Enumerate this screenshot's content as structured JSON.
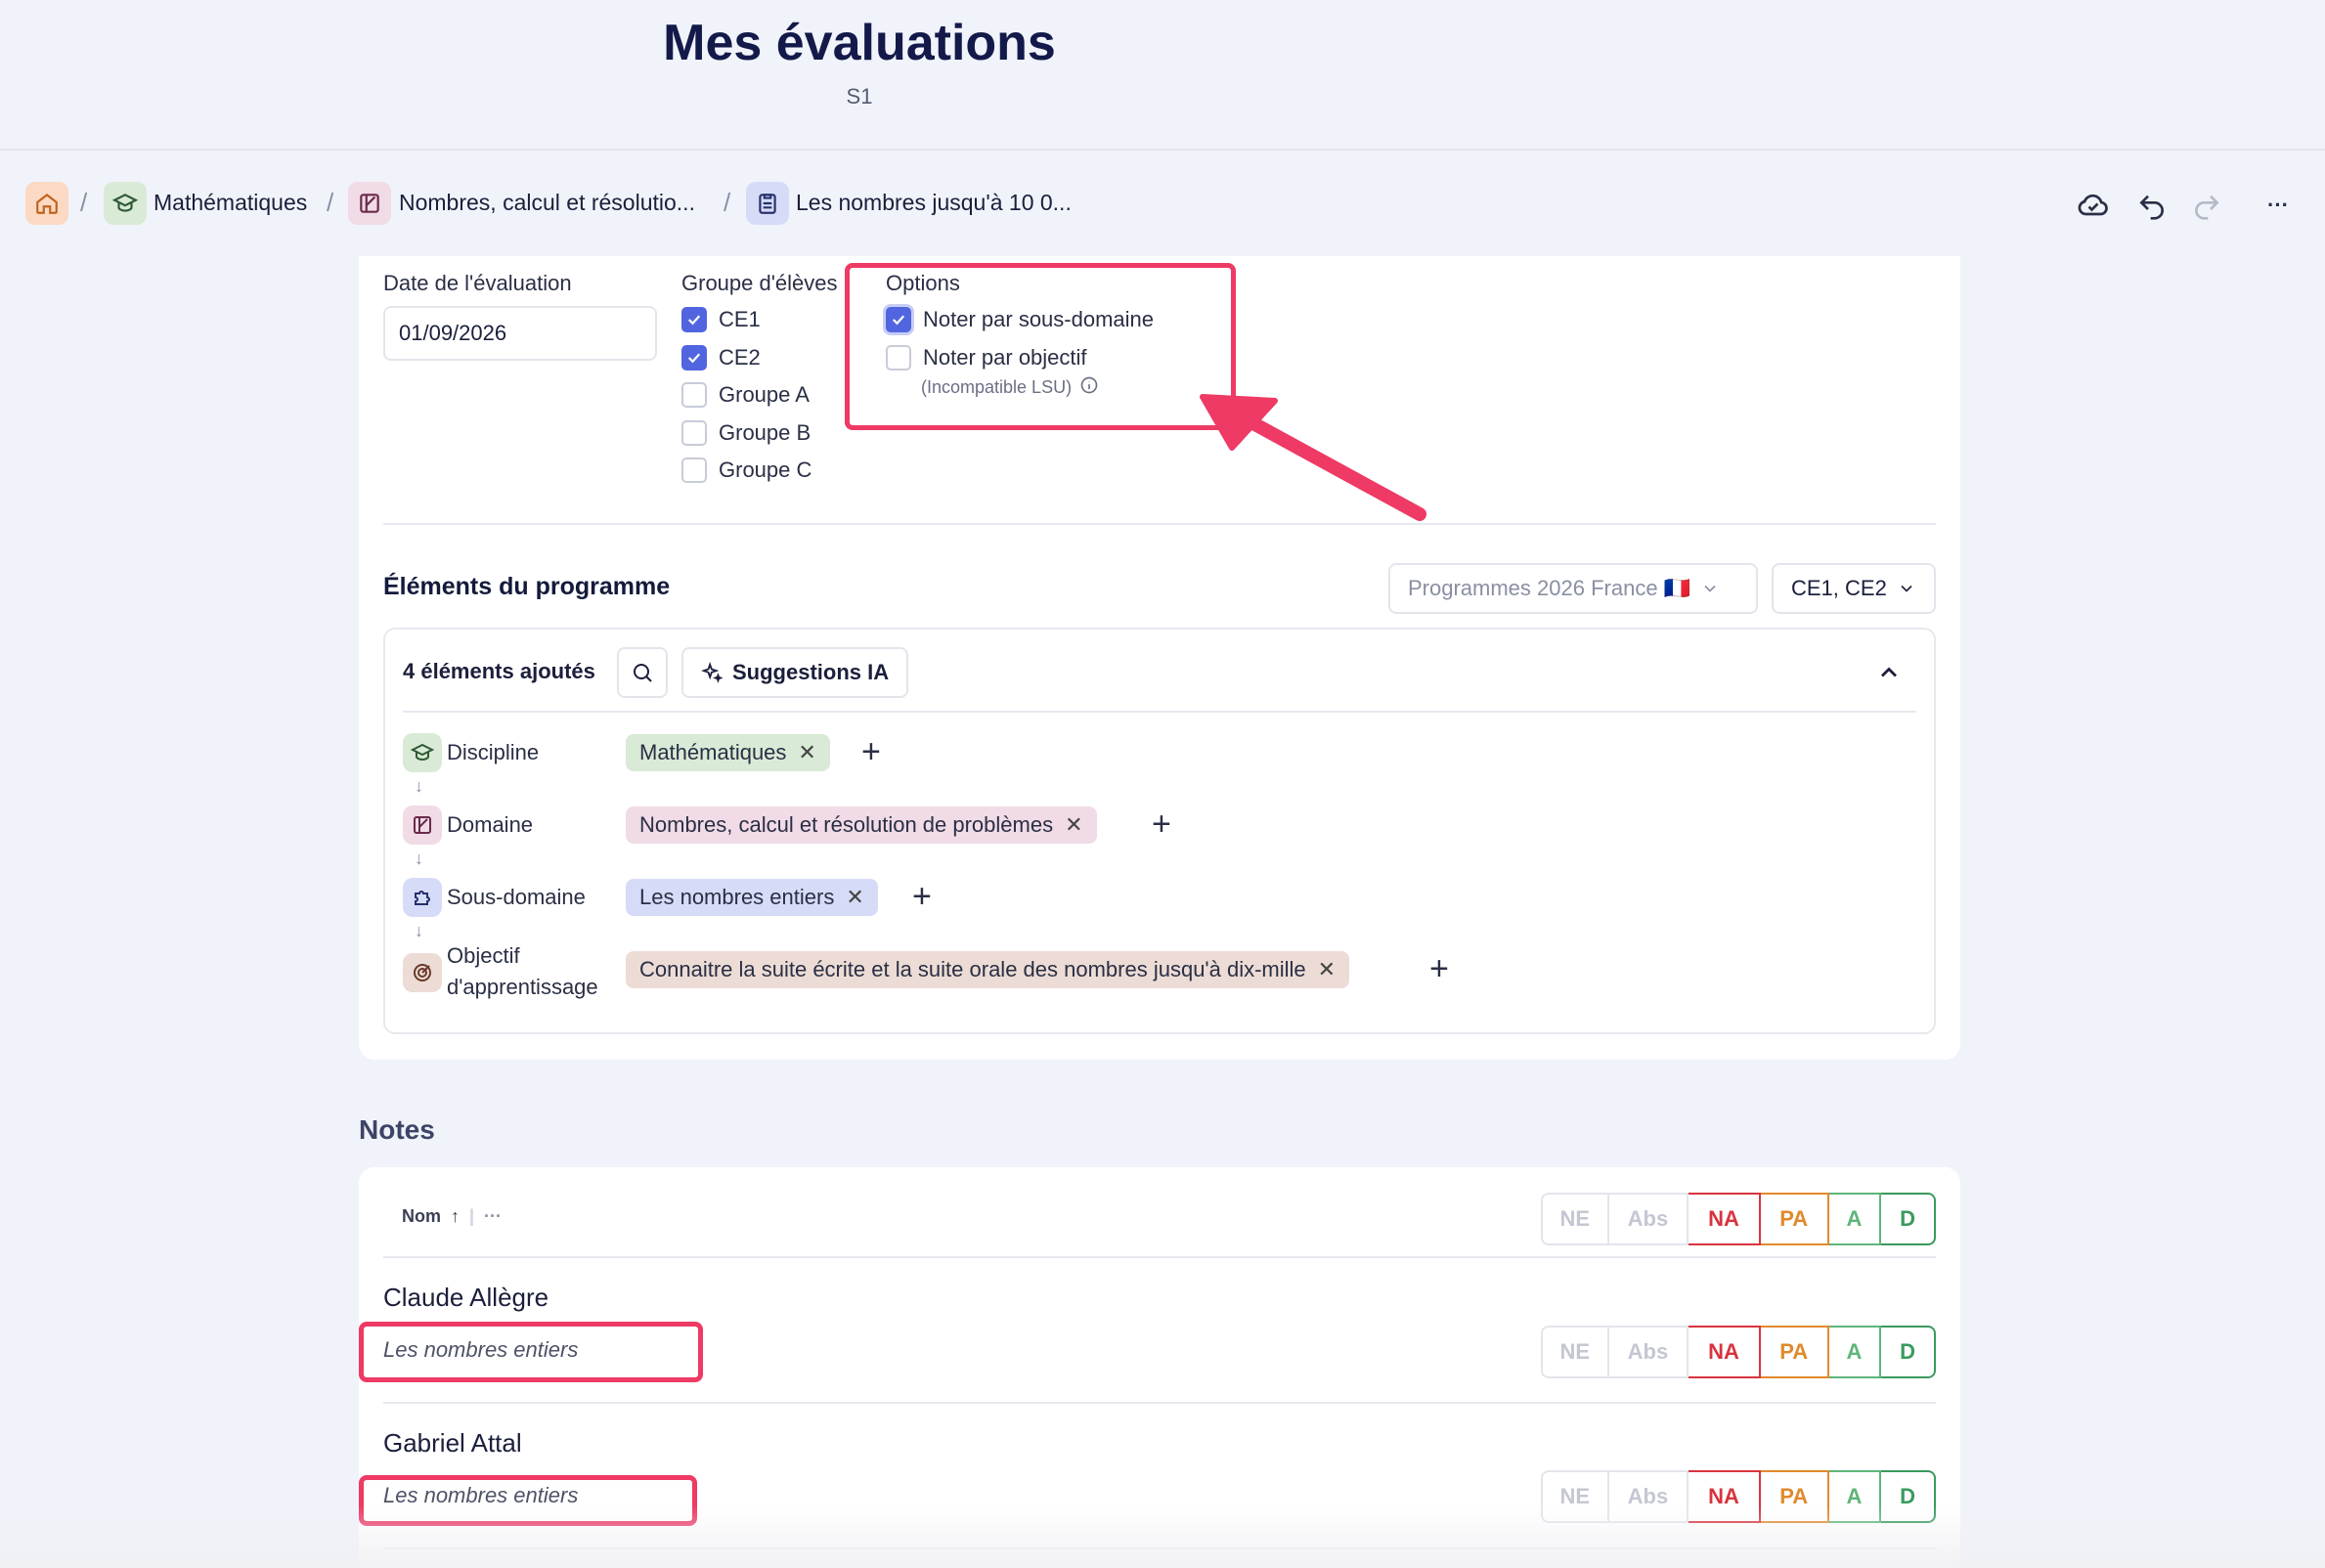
{
  "header": {
    "title": "Mes évaluations",
    "subtitle": "S1"
  },
  "breadcrumb": {
    "items": [
      {
        "label": "Mathématiques",
        "icon": "graduation-cap-icon"
      },
      {
        "label": "Nombres, calcul et résolutio...",
        "icon": "shapes-icon"
      },
      {
        "label": "Les nombres jusqu'à 10 0...",
        "icon": "clipboard-icon"
      }
    ],
    "separator": "/"
  },
  "toolbar": {
    "cloud": "cloud-check-icon",
    "undo": "undo-icon",
    "redo": "redo-icon",
    "more": "···"
  },
  "form": {
    "date_label": "Date de l'évaluation",
    "date_value": "01/09/2026",
    "group_label": "Groupe d'élèves",
    "groups": [
      {
        "label": "CE1",
        "checked": true
      },
      {
        "label": "CE2",
        "checked": true
      },
      {
        "label": "Groupe A",
        "checked": false
      },
      {
        "label": "Groupe B",
        "checked": false
      },
      {
        "label": "Groupe C",
        "checked": false
      }
    ],
    "options_label": "Options",
    "options": [
      {
        "label": "Noter par sous-domaine",
        "checked": true
      },
      {
        "label": "Noter par objectif",
        "checked": false
      }
    ],
    "options_note": "(Incompatible LSU)"
  },
  "programme": {
    "title": "Éléments du programme",
    "program_select": "Programmes 2026 France 🇫🇷",
    "level_select": "CE1, CE2",
    "count_label": "4 éléments ajoutés",
    "ai_button": "Suggestions IA",
    "levels": [
      {
        "label": "Discipline",
        "chip": "Mathématiques",
        "color": "#d9ead6"
      },
      {
        "label": "Domaine",
        "chip": "Nombres, calcul et résolution de problèmes",
        "color": "#f0dbe6"
      },
      {
        "label": "Sous-domaine",
        "chip": "Les nombres entiers",
        "color": "#d6dcf7"
      },
      {
        "label_line1": "Objectif",
        "label_line2": "d'apprentissage",
        "chip": "Connaitre la suite écrite et la suite orale des nombres jusqu'à dix-mille",
        "color": "#ecdcd5"
      }
    ]
  },
  "notes": {
    "title": "Notes",
    "sort_label": "Nom",
    "more": "···",
    "grades": [
      "NE",
      "Abs",
      "NA",
      "PA",
      "A",
      "D"
    ],
    "grade_colors": [
      "#c4c7d2",
      "#c4c7d2",
      "#d8343f",
      "#e08a2c",
      "#5fb57a",
      "#3a9a5d"
    ],
    "students": [
      {
        "name": "Claude Allègre",
        "sub": "Les nombres entiers"
      },
      {
        "name": "Gabriel Attal",
        "sub": "Les nombres entiers"
      }
    ]
  },
  "accent_color": "#5265e0",
  "highlight_color": "#ee3a64"
}
